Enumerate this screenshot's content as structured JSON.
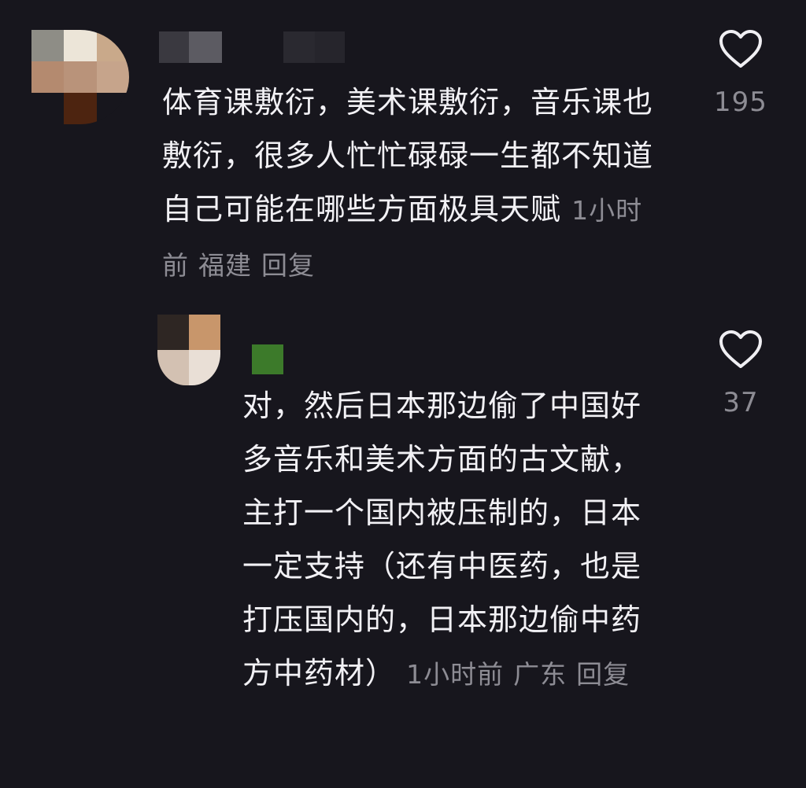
{
  "comments": [
    {
      "text": "体育课敷衍，美术课敷衍，音乐课也敷衍，很多人忙忙碌碌一生都不知道自己可能在哪些方面极具天赋",
      "time": "1小时前",
      "location": "福建",
      "reply_label": "回复",
      "likes": "195",
      "icon": "heart-outline-icon"
    },
    {
      "text": "对，然后日本那边偷了中国好多音乐和美术方面的古文献，主打一个国内被压制的，日本一定支持（还有中医药，也是打压国内的，日本那边偷中药方中药材）",
      "time": "1小时前",
      "location": "广东",
      "reply_label": "回复",
      "likes": "37",
      "icon": "heart-outline-icon"
    }
  ],
  "colors": {
    "background": "#17161d",
    "text": "#f2f1f5",
    "meta": "#8d8c94",
    "username_tag_green": "#3c7a2a"
  }
}
